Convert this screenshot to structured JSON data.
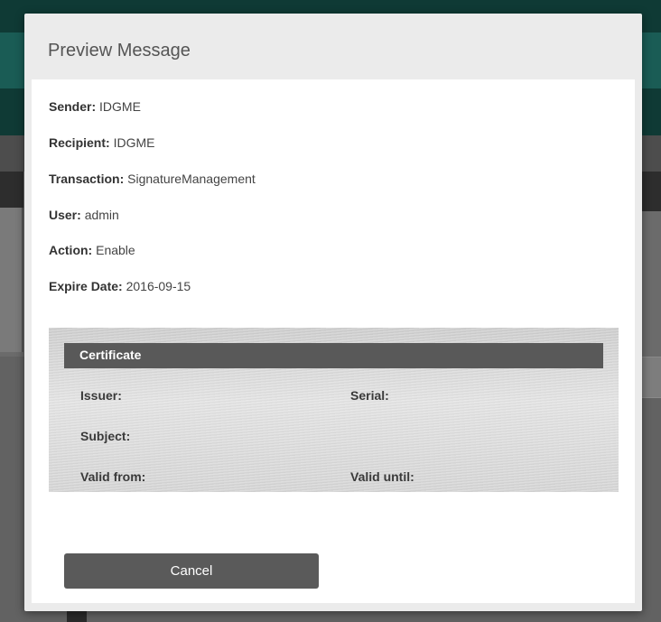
{
  "modal": {
    "title": "Preview Message",
    "fields": [
      {
        "label": "Sender:",
        "value": "IDGME"
      },
      {
        "label": "Recipient:",
        "value": "IDGME"
      },
      {
        "label": "Transaction:",
        "value": "SignatureManagement"
      },
      {
        "label": "User:",
        "value": "admin"
      },
      {
        "label": "Action:",
        "value": "Enable"
      },
      {
        "label": "Expire Date:",
        "value": "2016-09-15"
      }
    ],
    "certificate": {
      "heading": "Certificate",
      "issuer_label": "Issuer:",
      "serial_label": "Serial:",
      "subject_label": "Subject:",
      "valid_from_label": "Valid from:",
      "valid_until_label": "Valid until:"
    },
    "cancel_label": "Cancel"
  },
  "colors": {
    "modal_header_bg": "#ebebeb",
    "certificate_header_bg": "#595959",
    "button_bg": "#5a5a5a",
    "background_app_header": "#1a5c55"
  }
}
